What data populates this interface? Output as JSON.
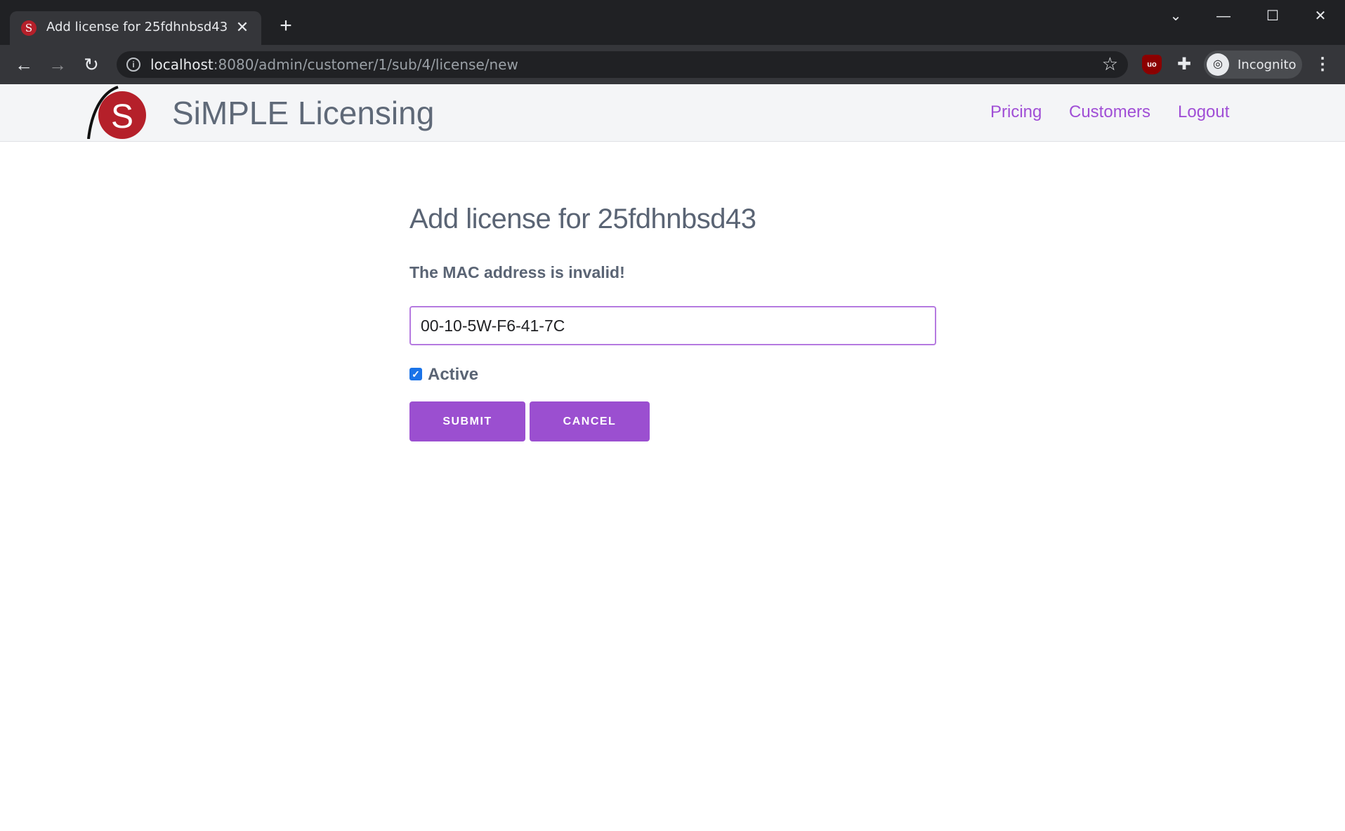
{
  "browser": {
    "tab_title": "Add license for 25fdhnbsd43",
    "tab_favicon_letter": "S",
    "url_host": "localhost",
    "url_rest": ":8080/admin/customer/1/sub/4/license/new",
    "profile_label": "Incognito",
    "ublock_badge": "uo"
  },
  "header": {
    "brand": "SiMPLE Licensing",
    "logo_letter": "S",
    "nav": [
      "Pricing",
      "Customers",
      "Logout"
    ]
  },
  "form": {
    "title": "Add license for 25fdhnbsd43",
    "error": "The MAC address is invalid!",
    "mac_value": "00-10-5W-F6-41-7C",
    "active_label": "Active",
    "active_checked": true,
    "submit_label": "SUBMIT",
    "cancel_label": "CANCEL"
  },
  "colors": {
    "accent": "#9b4fd0",
    "link": "#a04ed6",
    "logo_red": "#b5202a"
  }
}
